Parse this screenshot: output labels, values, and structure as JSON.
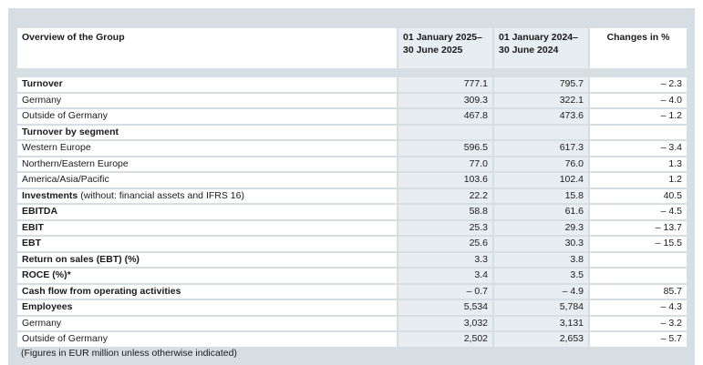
{
  "table": {
    "header": {
      "label": "Overview of the Group",
      "col_2025": [
        "01 January 2025–",
        "30 June 2025"
      ],
      "col_2024": [
        "01 January 2024–",
        "30 June 2024"
      ],
      "col_change": "Changes in %"
    },
    "rows": [
      {
        "label": "Turnover",
        "note": "",
        "v2025": "777.1",
        "v2024": "795.7",
        "change": "– 2.3",
        "bold": true
      },
      {
        "label": "Germany",
        "note": "",
        "v2025": "309.3",
        "v2024": "322.1",
        "change": "– 4.0",
        "bold": false
      },
      {
        "label": "Outside of Germany",
        "note": "",
        "v2025": "467.8",
        "v2024": "473.6",
        "change": "– 1.2",
        "bold": false
      },
      {
        "label": "Turnover by segment",
        "note": "",
        "v2025": "",
        "v2024": "",
        "change": "",
        "bold": true
      },
      {
        "label": "Western Europe",
        "note": "",
        "v2025": "596.5",
        "v2024": "617.3",
        "change": "– 3.4",
        "bold": false
      },
      {
        "label": "Northern/Eastern Europe",
        "note": "",
        "v2025": "77.0",
        "v2024": "76.0",
        "change": "1.3",
        "bold": false
      },
      {
        "label": "America/Asia/Pacific",
        "note": "",
        "v2025": "103.6",
        "v2024": "102.4",
        "change": "1.2",
        "bold": false
      },
      {
        "label": "Investments",
        "note": " (without: financial assets and IFRS 16)",
        "v2025": "22.2",
        "v2024": "15.8",
        "change": "40.5",
        "bold": true
      },
      {
        "label": "EBITDA",
        "note": "",
        "v2025": "58.8",
        "v2024": "61.6",
        "change": "– 4.5",
        "bold": true
      },
      {
        "label": "EBIT",
        "note": "",
        "v2025": "25.3",
        "v2024": "29.3",
        "change": "– 13.7",
        "bold": true
      },
      {
        "label": "EBT",
        "note": "",
        "v2025": "25.6",
        "v2024": "30.3",
        "change": "– 15.5",
        "bold": true
      },
      {
        "label": "Return on sales (EBT) (%)",
        "note": "",
        "v2025": "3.3",
        "v2024": "3.8",
        "change": "",
        "bold": true
      },
      {
        "label": "ROCE (%)*",
        "note": "",
        "v2025": "3.4",
        "v2024": "3.5",
        "change": "",
        "bold": true
      },
      {
        "label": "Cash flow from operating activities",
        "note": "",
        "v2025": "– 0.7",
        "v2024": "– 4.9",
        "change": "85.7",
        "bold": true
      },
      {
        "label": "Employees",
        "note": "",
        "v2025": "5,534",
        "v2024": "5,784",
        "change": "– 4.3",
        "bold": true
      },
      {
        "label": "Germany",
        "note": "",
        "v2025": "3,032",
        "v2024": "3,131",
        "change": "– 3.2",
        "bold": false
      },
      {
        "label": "Outside of Germany",
        "note": "",
        "v2025": "2,502",
        "v2024": "2,653",
        "change": "– 5.7",
        "bold": false
      }
    ]
  },
  "footnote": "(Figures in EUR million unless otherwise indicated)"
}
